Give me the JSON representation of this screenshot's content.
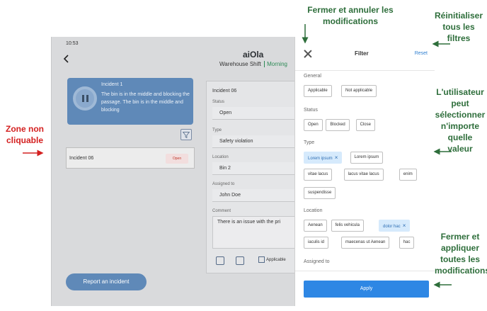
{
  "status_bar": {
    "time": "10:53"
  },
  "header": {
    "logo": "aiOla",
    "subtitle": "Warehouse Shift",
    "mode": "Morning"
  },
  "incident_card": {
    "title": "Incident 1",
    "description": "The bin is in the middle and blocking the passage. The bin is in the middle and blocking"
  },
  "incident_list": [
    {
      "label": "Incident 06",
      "status": "Open"
    }
  ],
  "report_button": "Report an incident",
  "detail": {
    "title": "Incident 06",
    "fields": [
      {
        "label": "Status",
        "value": "Open"
      },
      {
        "label": "Type",
        "value": "Safety violation"
      },
      {
        "label": "Location",
        "value": "Bin 2"
      },
      {
        "label": "Assigned to",
        "value": "John Doe"
      }
    ],
    "comment_label": "Comment",
    "comment": "There is an issue with the pri",
    "applicable_label": "Applicable"
  },
  "filter": {
    "title": "Filter",
    "reset": "Reset",
    "apply": "Apply",
    "sections": [
      {
        "label": "General",
        "chips": [
          {
            "text": "Applicable",
            "selected": false
          },
          {
            "text": "Not applicable",
            "selected": false
          }
        ]
      },
      {
        "label": "Status",
        "chips": [
          {
            "text": "Open",
            "selected": false
          },
          {
            "text": "Blocked",
            "selected": false
          },
          {
            "text": "Close",
            "selected": false
          }
        ]
      },
      {
        "label": "Type",
        "chips": [
          {
            "text": "Lorem ipsum",
            "selected": true
          },
          {
            "text": "Lorem ipsum",
            "selected": false
          },
          {
            "text": "vitae lacus",
            "selected": false
          },
          {
            "text": "lacus vitae lacus",
            "selected": false
          },
          {
            "text": "enim",
            "selected": false
          },
          {
            "text": "suspendisse",
            "selected": false
          }
        ]
      },
      {
        "label": "Location",
        "chips": [
          {
            "text": "Aenean",
            "selected": false
          },
          {
            "text": "felis vehicula",
            "selected": false
          },
          {
            "text": "dolor hac",
            "selected": true
          },
          {
            "text": "iaculis id",
            "selected": false
          },
          {
            "text": "maecenas ut Aenean",
            "selected": false
          },
          {
            "text": "hac",
            "selected": false
          }
        ]
      },
      {
        "label": "Assigned to",
        "chips": []
      }
    ]
  },
  "annotations": {
    "close": "Fermer et annuler les modifications",
    "reset": "Réinitialiser tous les filtres",
    "select": "L'utilisateur peut sélectionner n'importe quelle valeur",
    "apply": "Fermer et appliquer toutes les modifications",
    "zone": "Zone non cliquable"
  },
  "colors": {
    "annotation_green": "#2e6e3b",
    "annotation_red": "#d42020",
    "apply_blue": "#2e87e4",
    "chip_selected": "#d6eafc"
  }
}
